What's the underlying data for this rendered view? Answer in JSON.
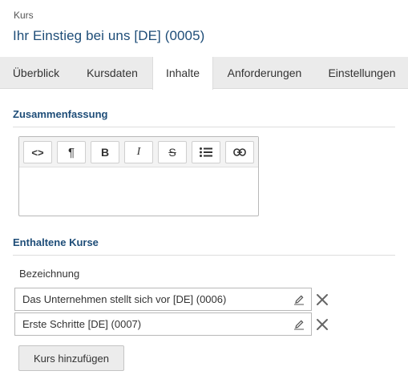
{
  "header": {
    "kicker": "Kurs",
    "title": "Ihr Einstieg bei uns [DE] (0005)"
  },
  "tabs": [
    {
      "label": "Überblick",
      "active": false
    },
    {
      "label": "Kursdaten",
      "active": false
    },
    {
      "label": "Inhalte",
      "active": true
    },
    {
      "label": "Anforderungen",
      "active": false
    },
    {
      "label": "Einstellungen",
      "active": false
    }
  ],
  "summary": {
    "heading": "Zusammenfassung",
    "toolbar": [
      {
        "glyph": "<>",
        "icon": "code-icon"
      },
      {
        "glyph": "¶",
        "icon": "paragraph-icon"
      },
      {
        "glyph": "B",
        "icon": "bold-icon"
      },
      {
        "glyph": "I",
        "icon": "italic-icon"
      },
      {
        "glyph": "S",
        "icon": "strikethrough-icon"
      },
      {
        "glyph": "",
        "icon": "bullet-list-icon"
      },
      {
        "glyph": "",
        "icon": "link-icon"
      }
    ]
  },
  "included_courses": {
    "heading": "Enthaltene Kurse",
    "column_label": "Bezeichnung",
    "rows": [
      {
        "name": "Das Unternehmen stellt sich vor [DE] (0006)"
      },
      {
        "name": "Erste Schritte [DE] (0007)"
      }
    ],
    "add_label": "Kurs hinzufügen"
  },
  "colors": {
    "accent": "#1e4d78",
    "tab_bar": "#ebebeb",
    "border": "#b8b8b8"
  }
}
